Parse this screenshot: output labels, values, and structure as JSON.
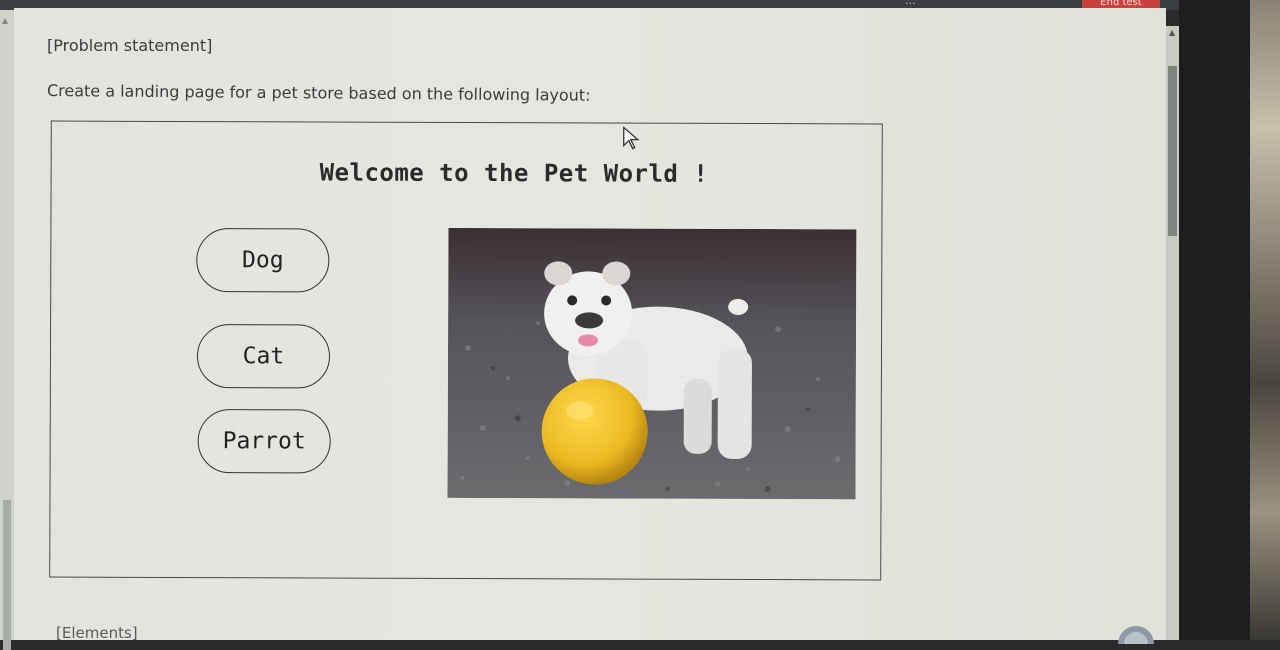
{
  "topbar": {
    "link_text": "...",
    "end_test_label": "End test"
  },
  "problem": {
    "heading": "[Problem statement]",
    "description": "Create a landing page for a pet store based on the following layout:"
  },
  "mockup": {
    "title": "Welcome to the Pet World !",
    "buttons": [
      {
        "label": "Dog"
      },
      {
        "label": "Cat"
      },
      {
        "label": "Parrot"
      }
    ],
    "image": {
      "subject": "bulldog with yellow ball",
      "ball_color": "#f2c12e"
    }
  },
  "elements_section": {
    "heading": "[Elements]"
  },
  "icons": [
    "cursor-icon",
    "help-icon",
    "scroll-up-icon"
  ]
}
